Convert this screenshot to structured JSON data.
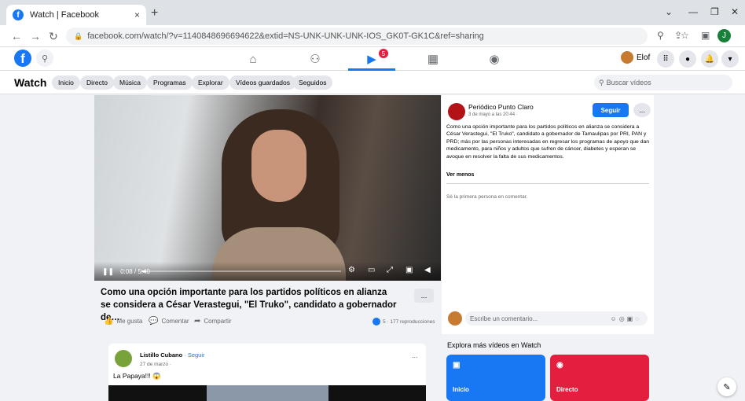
{
  "browser": {
    "tab_title": "Watch | Facebook",
    "tab_close": "×",
    "new_tab": "+",
    "url": "facebook.com/watch/?v=1140848696694622&extid=NS-UNK-UNK-UNK-IOS_GK0T-GK1C&ref=sharing",
    "profile_initial": "J"
  },
  "fb_nav": {
    "user_name": "Elof",
    "notification_count": "5"
  },
  "watch_bar": {
    "title": "Watch",
    "chips": [
      "Inicio",
      "Directo",
      "Música",
      "Programas",
      "Explorar",
      "Vídeos guardados",
      "Seguidos"
    ],
    "search_placeholder": "Buscar vídeos"
  },
  "video": {
    "time": "0:08 / 5:40",
    "progress": 0.024,
    "title": "Como una opción importante para los partidos políticos en alianza se considera a César Verastegui, \"El Truko\", candidato a gobernador de…",
    "more": "...",
    "actions": {
      "like": "Me gusta",
      "comment": "Comentar",
      "share": "Compartir"
    },
    "views": "5 · 177 reproducciones"
  },
  "post": {
    "page_name": "Periódico Punto Claro",
    "date": "3 de mayo a las 20:44 · ",
    "follow": "Seguir",
    "more": "...",
    "description": "Como una opción importante para los partidos políticos en alianza se considera a César Verastegui, \"El Truko\", candidato a gobernador de Tamaulipas por PRI, PAN y PRD; más por las personas interesadas en regresar los programas de apoyo que dan medicamento, para niños y adultos que sufren de cáncer, diabetes y esperan se avoque en resolver la falta de sus medicamentos.",
    "see_less": "Ver menos",
    "first_comment": "Sé la primera persona en comentar.",
    "comment_placeholder": "Escribe un comentario..."
  },
  "next_post": {
    "name": "Listillo Cubano",
    "follow": " · Seguir",
    "date": "27 de marzo · ",
    "caption": "La Papaya!!! 😱",
    "more": "..."
  },
  "explore": {
    "title": "Explora más vídeos en Watch",
    "cards": [
      {
        "label": "Inicio",
        "color": "#1877f2"
      },
      {
        "label": "Directo",
        "color": "#e41e3f"
      }
    ]
  }
}
